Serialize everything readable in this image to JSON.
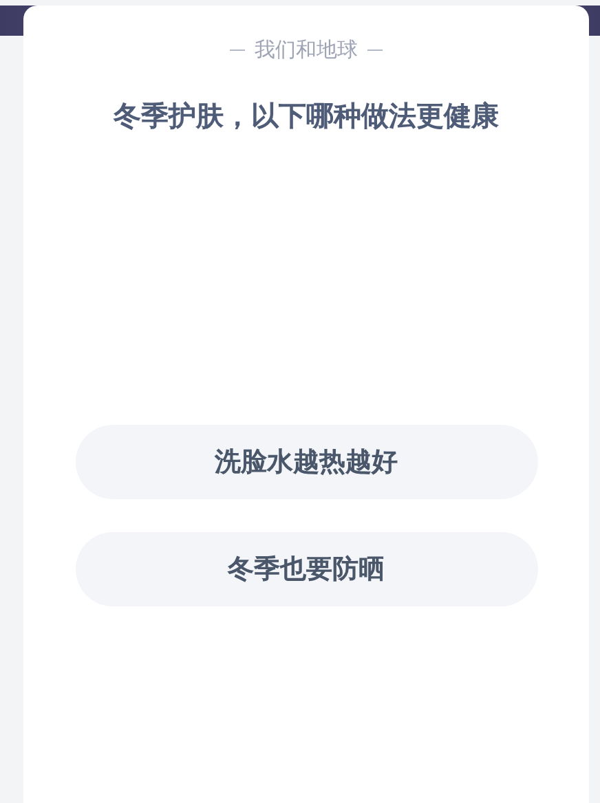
{
  "quiz": {
    "category": "我们和地球",
    "question": "冬季护肤，以下哪种做法更健康",
    "options": [
      {
        "label": "洗脸水越热越好"
      },
      {
        "label": "冬季也要防晒"
      }
    ]
  }
}
